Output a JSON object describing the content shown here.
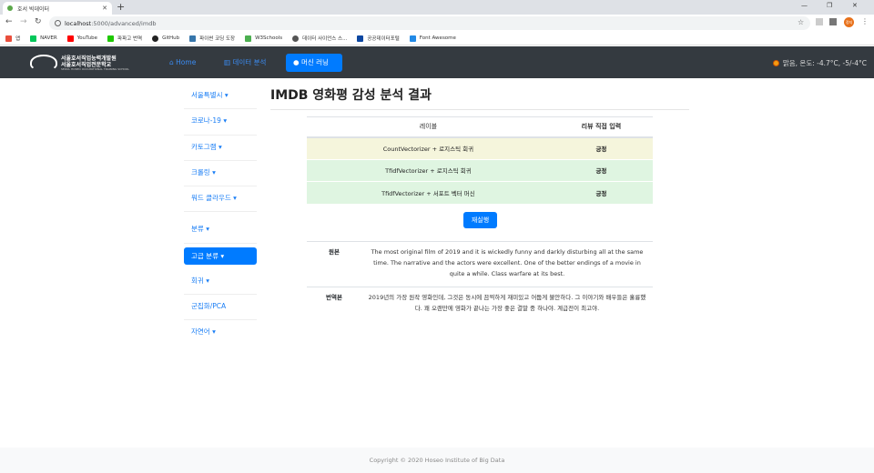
{
  "browser": {
    "tab_title": "호서 빅데이터",
    "url_host": "localhost",
    "url_path": ":5000/advanced/imdb",
    "profile_label": "정지",
    "bookmarks": [
      "앱",
      "NAVER",
      "YouTube",
      "파파고 번역",
      "GitHub",
      "파이썬 코딩 도장",
      "W3Schools",
      "데이터 사이언스 스...",
      "공공데이터포털",
      "Font Awesome"
    ]
  },
  "navbar": {
    "logo_line1": "서울호서직업능력개발원",
    "logo_line2": "서울호서직업전문학교",
    "logo_line3": "SEOUL HOSEO OCCUPATIONAL TRAINING SCHOOL",
    "links": [
      "Home",
      "데이터 분석",
      "머신 러닝"
    ],
    "weather": "맑음, 온도: -4.7°C, -5/-4°C"
  },
  "sidebar": {
    "items": [
      "서울특별시",
      "코로나-19",
      "카토그램",
      "크롤링",
      "워드 클라우드",
      "분류",
      "고급 분류",
      "회귀",
      "군집화/PCA",
      "자연어"
    ]
  },
  "main": {
    "title": "IMDB 영화평 감성 분석 결과",
    "table_headers": [
      "레이블",
      "리뷰 직접 입력"
    ],
    "rows": [
      {
        "label": "CountVectorizer + 로지스틱 회귀",
        "result": "긍정",
        "color": "#f5f5dc"
      },
      {
        "label": "TfidfVectorizer + 로지스틱 회귀",
        "result": "긍정",
        "color": "#dff5e1"
      },
      {
        "label": "TfidfVectorizer + 서포트 벡터 머신",
        "result": "긍정",
        "color": "#dff5e1"
      }
    ],
    "rerun_label": "재실행",
    "original_label": "원본",
    "original_text": "The most original film of 2019 and it is wickedly funny and darkly disturbing all at the same time. The narrative and the actors were excellent. One of the better endings of a movie in quite a while. Class warfare at its best.",
    "translation_label": "번역본",
    "translation_text": "2019년의 가장 원작 영화인데, 그것은 동시에 끔찍하게 재미있고 어둡게 불안하다. 그 이야기와 배우들은 훌륭했다. 꽤 오랜만에 영화가 끝나는 가장 좋은 결말 중 하나야. 계급전이 최고야."
  },
  "footer": {
    "text": "Copyright © 2020 Hoseo Institute of Big Data"
  }
}
